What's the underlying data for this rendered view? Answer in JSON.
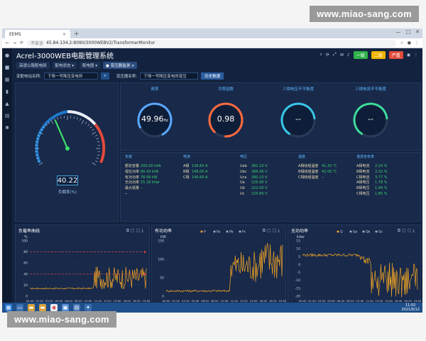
{
  "watermark_top": "www.miao-sang.com",
  "watermark_bottom": "www.miao-sang.com",
  "browser": {
    "tab_title": "EEMS",
    "tab_close": "×",
    "new_tab": "+",
    "nav_back": "←",
    "nav_forward": "→",
    "nav_reload": "⟳",
    "insecure": "不安全",
    "url": "45.84.134.2:8090/3000WEBV2/TransformerMonitor",
    "win_min": "—",
    "win_max": "□",
    "win_close": "✕"
  },
  "header": {
    "title": "Acrel-3000WEB电能管理系统",
    "btn_green": "一级",
    "btn_yellow": "二级",
    "btn_red": "严重"
  },
  "nav_tabs": [
    {
      "label": "高速公路配电网"
    },
    {
      "label": "配电状态 ▾"
    },
    {
      "label": "配电图 ▾"
    },
    {
      "label": "● 变压器监测 ×"
    }
  ],
  "filter": {
    "station_label": "变配电站名称:",
    "station_value": "下埠一号降压变电所",
    "transformer_label": "变压器名称:",
    "transformer_value": "下埠一号降压变电所变压",
    "history_btn": "历史数据"
  },
  "gauge": {
    "value": "40.22",
    "label": "负载率(%)",
    "fraction": 0.4022
  },
  "rings": [
    {
      "title": "频率",
      "value": "49.96",
      "unit": "Hz",
      "color": "#5aa7ff"
    },
    {
      "title": "功率因数",
      "value": "0.98",
      "unit": "",
      "color": "#ff6b3d"
    },
    {
      "title": "三相电压不平衡度",
      "value": "--",
      "unit": "",
      "color": "#38c6e8"
    },
    {
      "title": "三相电流不平衡度",
      "value": "--",
      "unit": "",
      "color": "#3ddc9a"
    }
  ],
  "table": {
    "headers": [
      "负载",
      "电流",
      "电压",
      "温度",
      "谐波含有率"
    ],
    "load": [
      {
        "name": "额定容量",
        "value": "200.00 kVA"
      },
      {
        "name": "视在功率",
        "value": "80.43 kVA"
      },
      {
        "name": "有功功率",
        "value": "78.99 kW"
      },
      {
        "name": "无功功率",
        "value": "15.18 kVar"
      },
      {
        "name": "最大需量",
        "value": "--"
      },
      {
        "name": "--",
        "value": ""
      }
    ],
    "current": [
      {
        "name": "A相",
        "value": "136.60 A"
      },
      {
        "name": "B相",
        "value": "146.00 A"
      },
      {
        "name": "C相",
        "value": "140.60 A"
      }
    ],
    "voltage": [
      {
        "name": "Uab",
        "value": "391.10 V"
      },
      {
        "name": "Ubc",
        "value": "386.40 V"
      },
      {
        "name": "Uca",
        "value": "390.10 V"
      },
      {
        "name": "Ua",
        "value": "225.90 V"
      },
      {
        "name": "Ub",
        "value": "222.00 V"
      },
      {
        "name": "Uc",
        "value": "225.80 V"
      }
    ],
    "temperature": [
      {
        "name": "A相绕组温度",
        "value": "41.20 ℃"
      },
      {
        "name": "B相绕组温度",
        "value": "42.00 ℃"
      },
      {
        "name": "C相绕组温度",
        "value": "--"
      }
    ],
    "harmonic": [
      {
        "name": "A相电流",
        "value": "2.24 %"
      },
      {
        "name": "B相电流",
        "value": "3.32 %"
      },
      {
        "name": "C相电流",
        "value": "3.77 %"
      },
      {
        "name": "A相电压",
        "value": "1.78 %"
      },
      {
        "name": "B相电压",
        "value": "1.94 %"
      },
      {
        "name": "C相电压",
        "value": "1.85 %"
      }
    ]
  },
  "charts": [
    {
      "title": "负载率曲线",
      "unit": "%",
      "yticks": [
        "100",
        "80",
        "60",
        "40",
        "20",
        "0"
      ],
      "legend": []
    },
    {
      "title": "有功功率",
      "unit": "kW",
      "yticks": [
        "150",
        "100",
        "50",
        "0"
      ],
      "legend": [
        "P",
        "Pa",
        "Pb",
        "Pc"
      ]
    },
    {
      "title": "无功功率",
      "unit": "kVar",
      "yticks": [
        "15",
        "10",
        "5",
        "0",
        "-5",
        "-10",
        "-15",
        "-20"
      ],
      "legend": [
        "Q",
        "Qa",
        "Qb",
        "Qc"
      ]
    }
  ],
  "chart_times": [
    "00:00",
    "01:40",
    "03:20",
    "05:00",
    "06:40",
    "08:20",
    "10:00",
    "11:40",
    "13:20",
    "15:00",
    "16:40",
    "18:20",
    "19:50"
  ],
  "taskbar": {
    "time": "11:02",
    "date": "2021/6/12"
  },
  "colors": {
    "accent": "#5fb8ff",
    "series": "#f5a623",
    "danger": "#ff4a3d",
    "ok": "#3bd16f"
  }
}
